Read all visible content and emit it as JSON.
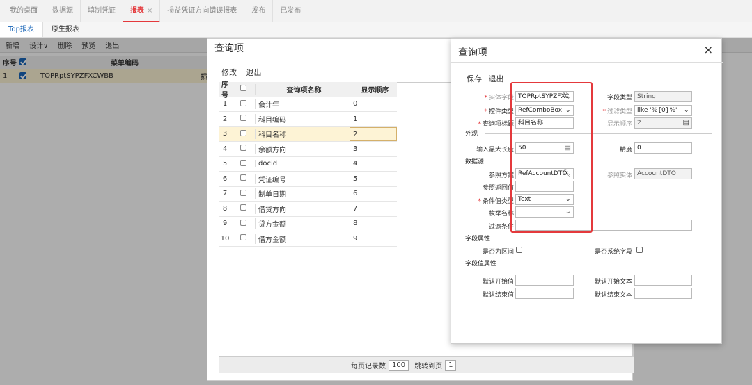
{
  "topnav": {
    "tabs": [
      "我的桌面",
      "数据源",
      "填制凭证",
      "报表",
      "损益凭证方向错误报表",
      "发布",
      "已发布"
    ],
    "active_close": "×"
  },
  "subtabs": [
    "Top报表",
    "原生报表"
  ],
  "main_toolbar": [
    "新增",
    "设计∨",
    "删除",
    "预览",
    "退出"
  ],
  "main_table": {
    "headers": {
      "index": "序号",
      "code": "菜单编码"
    },
    "rows": [
      {
        "index": "1",
        "code": "TOPRptSYPZFXCWBB",
        "extra": "损"
      }
    ]
  },
  "dialog_left": {
    "title": "查询项",
    "toolbar": {
      "edit": "修改",
      "exit": "退出"
    },
    "headers": {
      "index": "序号",
      "name": "查询项名称",
      "order": "显示顺序"
    },
    "rows": [
      {
        "index": "1",
        "name": "会计年",
        "order": "0"
      },
      {
        "index": "2",
        "name": "科目编码",
        "order": "1"
      },
      {
        "index": "3",
        "name": "科目名称",
        "order": "2"
      },
      {
        "index": "4",
        "name": "余额方向",
        "order": "3"
      },
      {
        "index": "5",
        "name": "docid",
        "order": "4"
      },
      {
        "index": "6",
        "name": "凭证编号",
        "order": "5"
      },
      {
        "index": "7",
        "name": "制单日期",
        "order": "6"
      },
      {
        "index": "8",
        "name": "借贷方向",
        "order": "7"
      },
      {
        "index": "9",
        "name": "贷方金额",
        "order": "8"
      },
      {
        "index": "10",
        "name": "借方金额",
        "order": "9"
      }
    ],
    "footer": {
      "per_page_label": "每页记录数",
      "per_page": "100",
      "jump_label": "跳转到页",
      "jump_page": "1"
    }
  },
  "dialog_right": {
    "title": "查询项",
    "close": "×",
    "toolbar": {
      "save": "保存",
      "exit": "退出"
    },
    "fields": {
      "entity_field_label": "实体字段",
      "entity_field": "TOPRptSYPZFXC",
      "field_type_label": "字段类型",
      "field_type": "String",
      "control_type_label": "控件类型",
      "control_type": "RefComboBox",
      "filter_type_label": "过滤类型",
      "filter_type": "like '%{0}%'",
      "query_title_label": "查询项标题",
      "query_title": "科目名称",
      "display_order_label": "显示顺序",
      "display_order": "2"
    },
    "section_appearance": "外观",
    "max_len_label": "输入最大长度",
    "max_len": "50",
    "precision_label": "精度",
    "precision": "0",
    "section_datasource": "数据源",
    "ref_scheme_label": "参照方案",
    "ref_scheme": "RefAccountDTO",
    "ref_entity_label": "参照实体",
    "ref_entity": "AccountDTO",
    "ref_return_label": "参照返回值",
    "cond_type_label": "条件值类型",
    "cond_type": "Text",
    "enum_label": "枚举名称",
    "filter_cond_label": "过滤条件",
    "section_props": "字段属性",
    "is_range_label": "是否为区间",
    "is_system_label": "是否系统字段",
    "section_value_props": "字段值属性",
    "default_start_label": "默认开始值",
    "default_start_text_label": "默认开始文本",
    "default_end_label": "默认结束值",
    "default_end_text_label": "默认结束文本"
  }
}
